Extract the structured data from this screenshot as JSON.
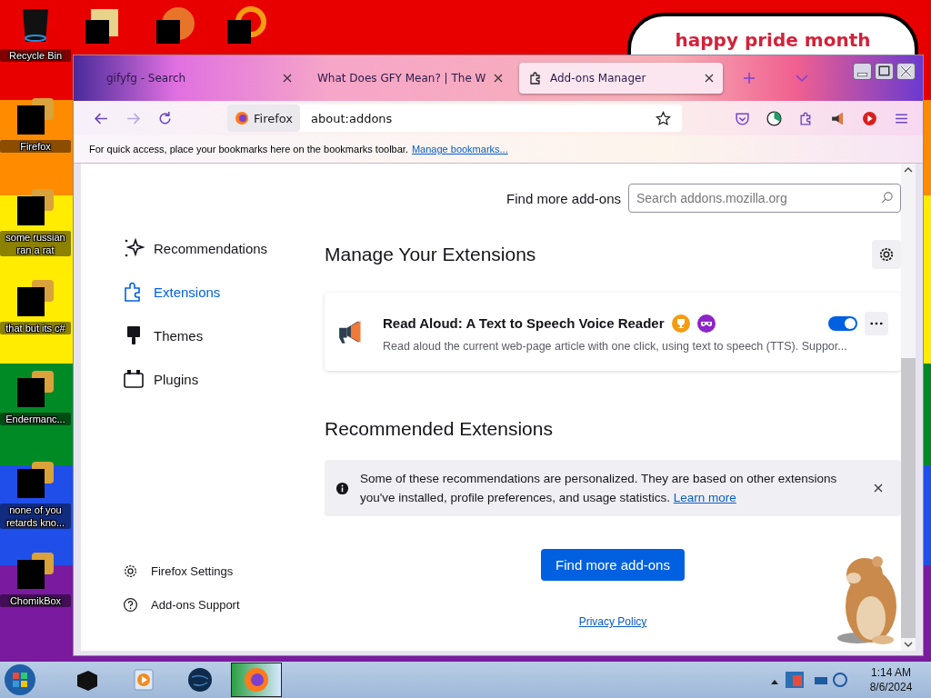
{
  "desktop": {
    "banner": "happy pride month",
    "icons": [
      {
        "label": "Recycle Bin",
        "kind": "bin"
      },
      {
        "label": "Firefox",
        "kind": "redacted"
      },
      {
        "label": "some russian ran a rat",
        "kind": "redacted"
      },
      {
        "label": "that but its c#",
        "kind": "redacted"
      },
      {
        "label": "Endermanc...",
        "kind": "redacted"
      },
      {
        "label": "none of you retards kno...",
        "kind": "redacted"
      },
      {
        "label": "ChomikBox",
        "kind": "redacted"
      }
    ]
  },
  "browser": {
    "tabs": [
      {
        "title": "gifyfg - Search",
        "selected": false
      },
      {
        "title": "What Does GFY Mean? | The W",
        "selected": false
      },
      {
        "title": "Add-ons Manager",
        "selected": true
      }
    ],
    "identity": "Firefox",
    "url": "about:addons",
    "bookmarks_notice": {
      "text": "For quick access, place your bookmarks here on the bookmarks toolbar.",
      "link": "Manage bookmarks..."
    }
  },
  "addons": {
    "find_more_label": "Find more add-ons",
    "search": {
      "placeholder": "Search addons.mozilla.org"
    },
    "sidebar": [
      {
        "label": "Recommendations",
        "selected": false,
        "kind": "sparkle"
      },
      {
        "label": "Extensions",
        "selected": true,
        "kind": "puzzle"
      },
      {
        "label": "Themes",
        "selected": false,
        "kind": "brush"
      },
      {
        "label": "Plugins",
        "selected": false,
        "kind": "plugin"
      }
    ],
    "sidebar_footer": [
      {
        "label": "Firefox Settings",
        "kind": "gear"
      },
      {
        "label": "Add-ons Support",
        "kind": "help"
      }
    ],
    "heading": "Manage Your Extensions",
    "extension": {
      "name": "Read Aloud: A Text to Speech Voice Reader",
      "description": "Read aloud the current web-page article with one click, using text to speech (TTS). Suppor...",
      "enabled": true
    },
    "recommended_heading": "Recommended Extensions",
    "notice": {
      "text": "Some of these recommendations are personalized. They are based on other extensions you've installed, profile preferences, and usage statistics.",
      "link": "Learn more"
    },
    "find_button": "Find more add-ons",
    "privacy_link": "Privacy Policy"
  },
  "taskbar": {
    "items": [
      {
        "kind": "box",
        "selected": false
      },
      {
        "kind": "media",
        "selected": false
      },
      {
        "kind": "globe",
        "selected": false
      },
      {
        "kind": "firefox",
        "selected": true
      }
    ],
    "time": "1:14 AM",
    "date": "8/6/2024"
  }
}
